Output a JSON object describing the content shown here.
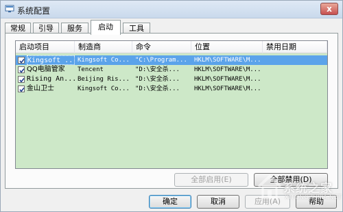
{
  "window": {
    "title": "系统配置",
    "close_label": "x"
  },
  "tabs": [
    "常规",
    "引导",
    "服务",
    "启动",
    "工具"
  ],
  "active_tab": "启动",
  "list": {
    "columns": [
      "启动项目",
      "制造商",
      "命令",
      "位置",
      "禁用日期"
    ],
    "rows": [
      {
        "checked": true,
        "name": "Kingsoft ...",
        "maker": "Kingsoft Co...",
        "command": "\"C:\\Program...",
        "location": "HKLM\\SOFTWARE\\M...",
        "date": "",
        "selected": true
      },
      {
        "checked": true,
        "name": "QQ电脑管家",
        "maker": "Tencent",
        "command": "\"D:\\安全杀...",
        "location": "HKLM\\SOFTWARE\\M...",
        "date": "",
        "selected": false
      },
      {
        "checked": true,
        "name": "Rising An...",
        "maker": "Beijing Ris...",
        "command": "\"D:\\安全杀...",
        "location": "HKLM\\SOFTWARE\\M...",
        "date": "",
        "selected": false
      },
      {
        "checked": true,
        "name": "金山卫士",
        "maker": "Kingsoft Co...",
        "command": "\"D:\\安全杀...",
        "location": "HKLM\\SOFTWARE\\M...",
        "date": "",
        "selected": false
      }
    ]
  },
  "buttons": {
    "enable_all": "全部启用(E)",
    "disable_all": "全部禁用(D)",
    "ok": "确定",
    "cancel": "取消",
    "apply": "应用(A)",
    "help": "帮助"
  },
  "watermark": {
    "title": "系统之家",
    "sub": "XITONGZHIJIA.NET"
  }
}
